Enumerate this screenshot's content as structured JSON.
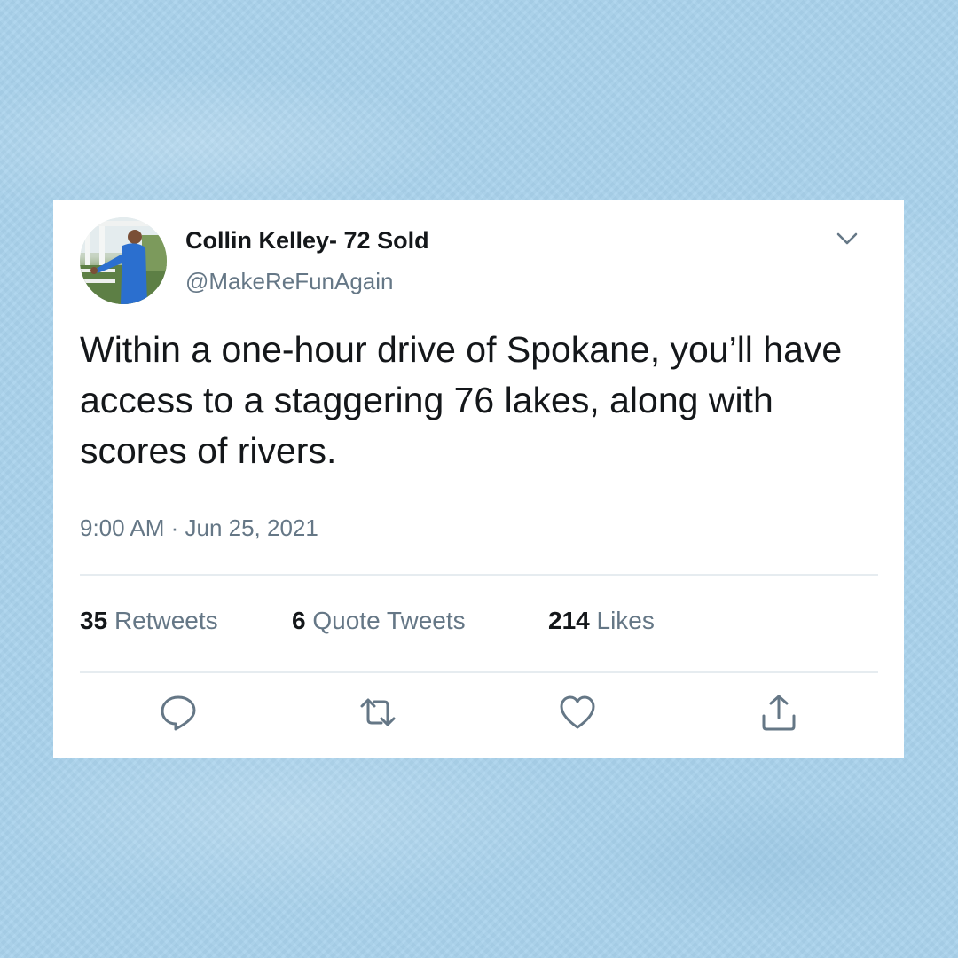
{
  "tweet": {
    "author_name": "Collin Kelley- 72 Sold",
    "handle": "@MakeReFunAgain",
    "text": "Within a one-hour drive of Spokane, you’ll have access to a staggering 76 lakes, along with scores of rivers.",
    "timestamp": "9:00 AM · Jun 25, 2021"
  },
  "stats": {
    "retweets_count": "35",
    "retweets_label": "Retweets",
    "quote_tweets_count": "6",
    "quote_tweets_label": "Quote Tweets",
    "likes_count": "214",
    "likes_label": "Likes"
  },
  "actions": [
    {
      "icon": "reply-icon"
    },
    {
      "icon": "retweet-icon"
    },
    {
      "icon": "like-icon"
    },
    {
      "icon": "share-icon"
    }
  ],
  "colors": {
    "background": "#a9d2ec",
    "card": "#ffffff",
    "primary_text": "#14171a",
    "secondary_text": "#657786",
    "divider": "#e6ecf0"
  }
}
